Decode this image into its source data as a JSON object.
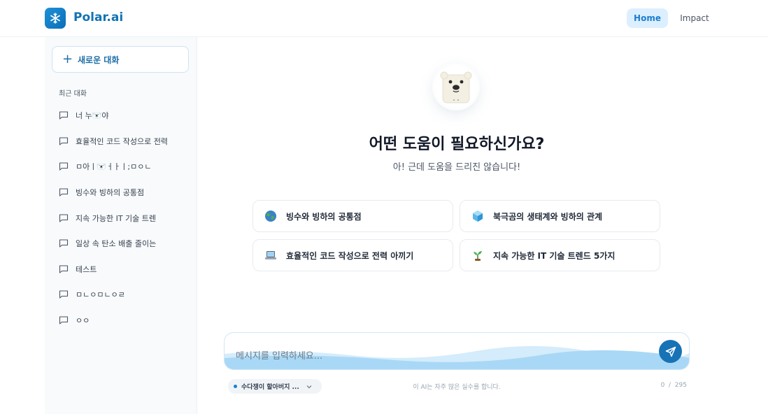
{
  "header": {
    "brand": "Polar.ai",
    "nav": {
      "home": "Home",
      "impact": "Impact"
    }
  },
  "sidebar": {
    "new_chat_label": "새로운 대화",
    "recent_title": "최근 대화",
    "conversations": [
      "너 누🐻‍❄️야",
      "효율적인 코드 작성으로 전력",
      "ㅁ아ㅣ🐻‍❄️ㅓㅏㅣ;ㅁㅇㄴ",
      "빙수와 빙하의 공통점",
      "지속 가능한 IT 기술 트렌",
      "일상 속 탄소 배출 줄이는",
      "테스트",
      "ㅁㄴㅇㅁㄴㅇㄹ",
      "ㅇㅇ"
    ]
  },
  "main": {
    "headline": "어떤 도움이 필요하신가요?",
    "subline": "아! 근데 도움을 드리진 않습니다!",
    "suggestions": [
      {
        "icon": "globe-icon",
        "text": "빙수와 빙하의 공통점"
      },
      {
        "icon": "ice-cube-icon",
        "text": "북극곰의 생태계와 빙하의 관계"
      },
      {
        "icon": "laptop-icon",
        "text": "효율적인 코드 작성으로 전력 아끼기"
      },
      {
        "icon": "seedling-icon",
        "text": "지속 가능한 IT 기술 트렌드 5가지"
      }
    ]
  },
  "composer": {
    "placeholder": "메시지를 입력하세요...",
    "model_label": "수다쟁이 할아버지 ...",
    "disclaimer": "이 AI는 자주 많은 실수를 합니다.",
    "counter": "0  /  295"
  },
  "colors": {
    "accent": "#1a7fd0",
    "brand": "#1273b3"
  }
}
